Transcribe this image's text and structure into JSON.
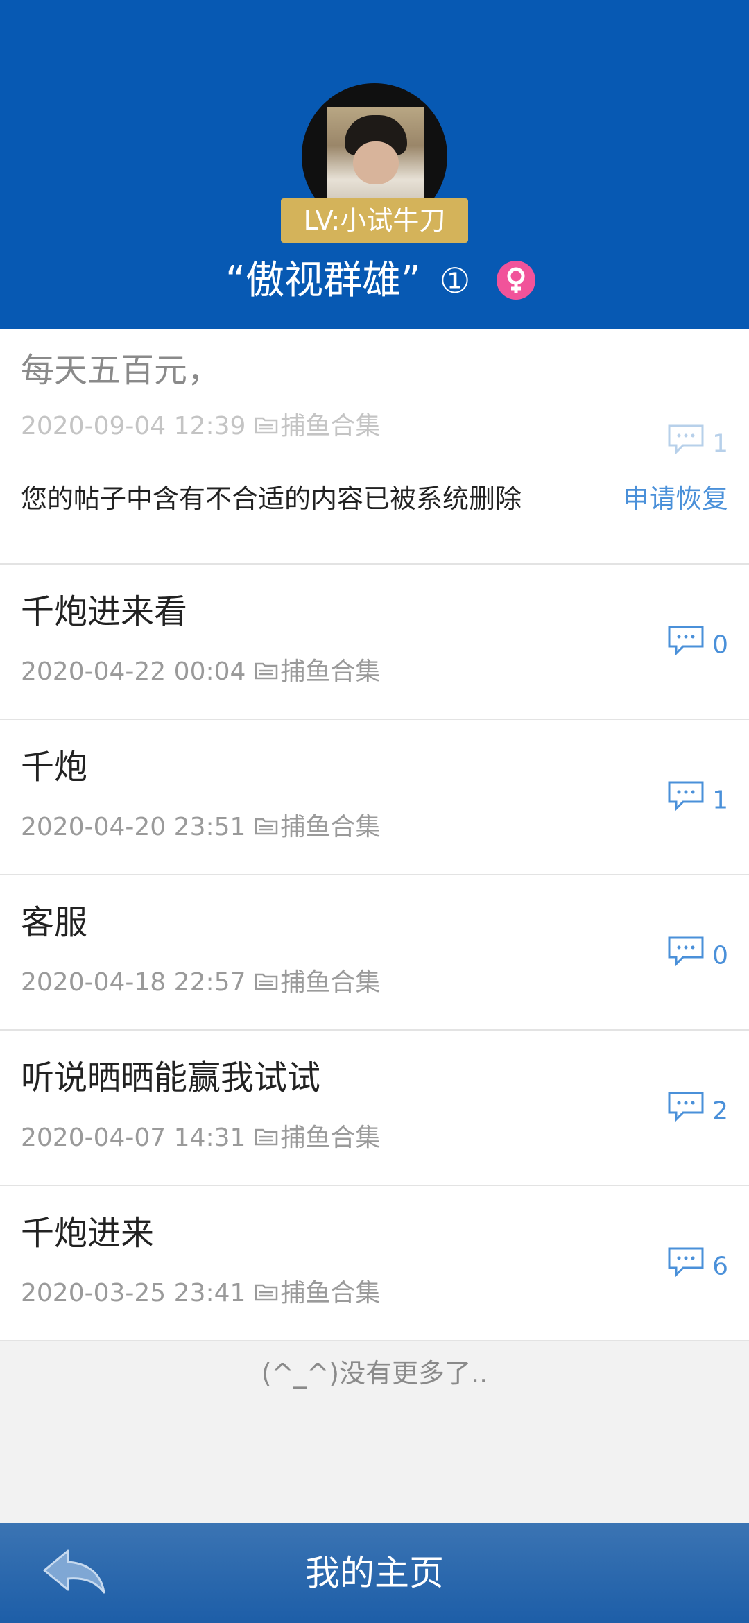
{
  "profile": {
    "level_badge": "LV:小试牛刀",
    "username": "“傲视群雄”",
    "level_number": "①",
    "gender": "female-icon"
  },
  "posts": [
    {
      "title": "每天五百元，",
      "datetime": "2020-09-04 12:39",
      "category": "捕鱼合集",
      "comments": "1",
      "notice": "您的帖子中含有不合适的内容已被系统删除",
      "restore_label": "申请恢复"
    },
    {
      "title": "千炮进来看",
      "datetime": "2020-04-22 00:04",
      "category": "捕鱼合集",
      "comments": "0"
    },
    {
      "title": "千炮",
      "datetime": "2020-04-20 23:51",
      "category": "捕鱼合集",
      "comments": "1"
    },
    {
      "title": "客服",
      "datetime": "2020-04-18 22:57",
      "category": "捕鱼合集",
      "comments": "0"
    },
    {
      "title": "听说晒晒能赢我试试",
      "datetime": "2020-04-07 14:31",
      "category": "捕鱼合集",
      "comments": "2"
    },
    {
      "title": "千炮进来",
      "datetime": "2020-03-25 23:41",
      "category": "捕鱼合集",
      "comments": "6"
    }
  ],
  "footer_note": "(^_^)没有更多了..",
  "bottom_bar": {
    "title": "我的主页",
    "back_icon": "back-arrow-icon"
  },
  "colors": {
    "header": "#0759b3",
    "accent": "#4a90d9",
    "badge": "#d4b35a",
    "gender": "#f1539a"
  }
}
